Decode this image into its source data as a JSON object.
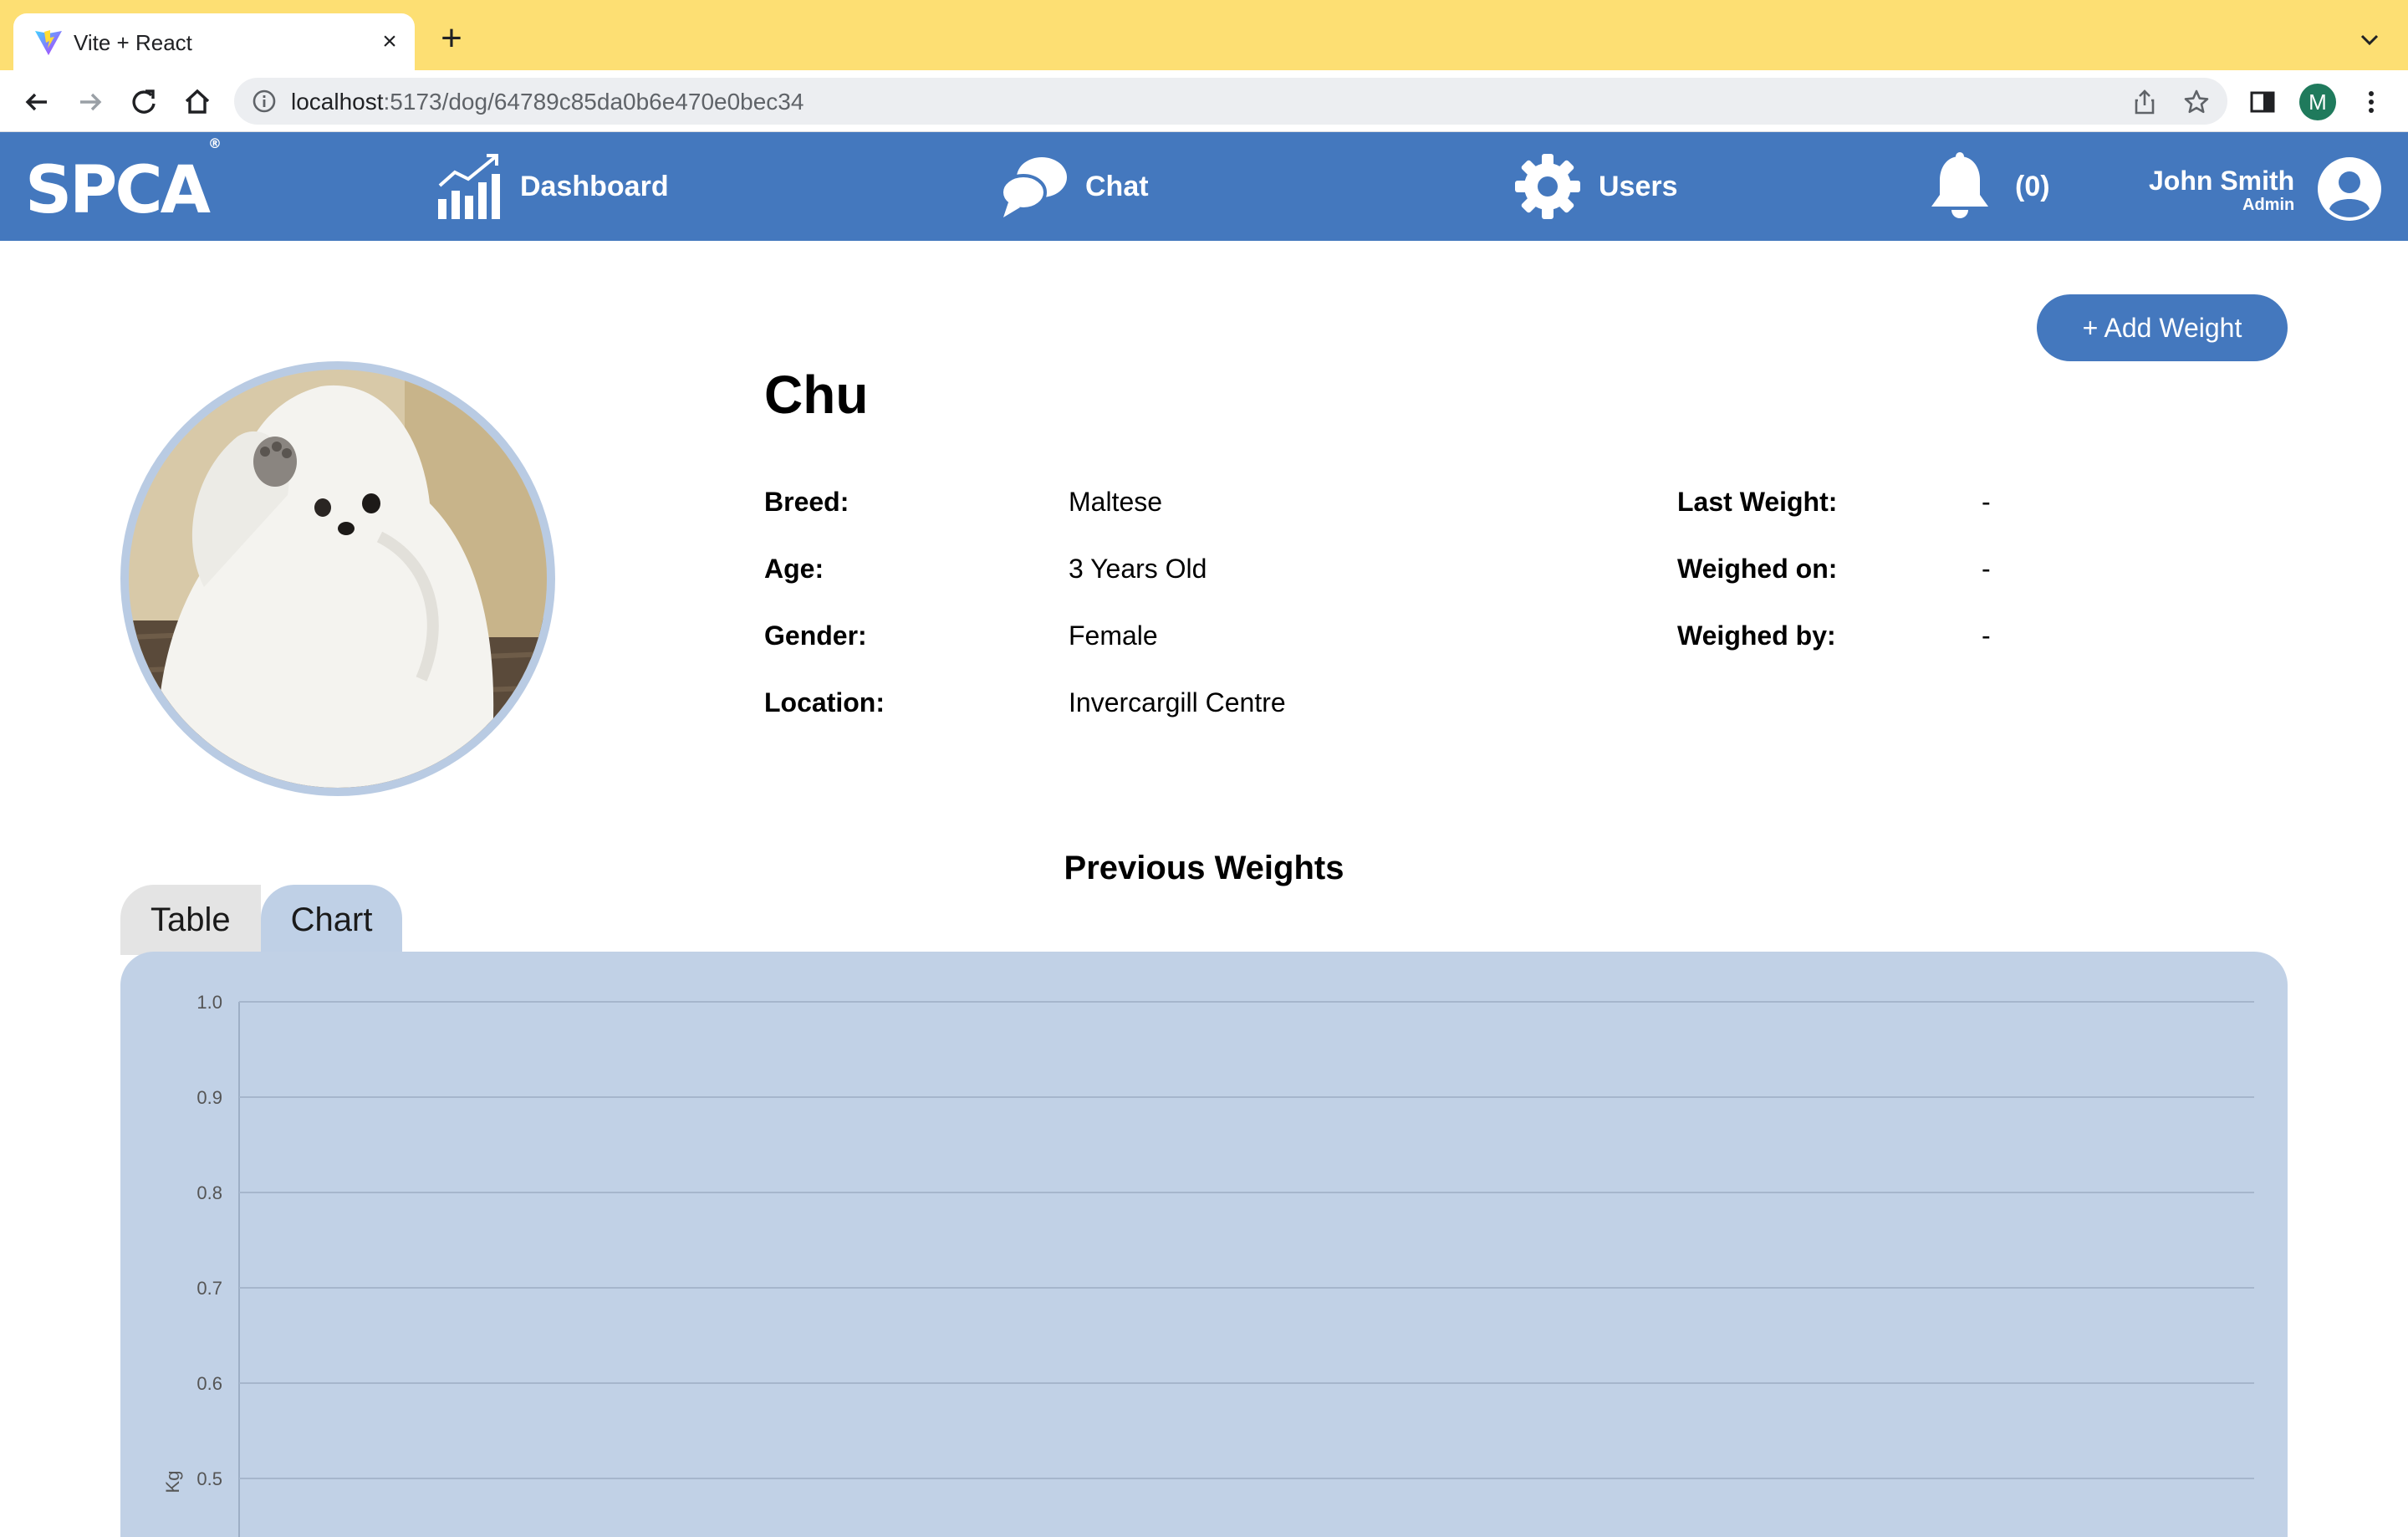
{
  "browser": {
    "tab_title": "Vite + React",
    "url_host": "localhost",
    "url_path": ":5173/dog/64789c85da0b6e470e0bec34",
    "profile_initial": "M"
  },
  "nav": {
    "logo": "SPCA",
    "logo_mark": "®",
    "dashboard": "Dashboard",
    "chat": "Chat",
    "users": "Users",
    "notifications": "(0)",
    "user_name": "John Smith",
    "user_role": "Admin"
  },
  "actions": {
    "add_weight": "+ Add Weight"
  },
  "dog": {
    "name": "Chu",
    "breed_label": "Breed:",
    "breed": "Maltese",
    "age_label": "Age:",
    "age": "3 Years Old",
    "gender_label": "Gender:",
    "gender": "Female",
    "location_label": "Location:",
    "location": "Invercargill Centre",
    "last_weight_label": "Last Weight:",
    "last_weight": "-",
    "weighed_on_label": "Weighed on:",
    "weighed_on": "-",
    "weighed_by_label": "Weighed by:",
    "weighed_by": "-"
  },
  "weights": {
    "title": "Previous Weights",
    "tabs": [
      "Table",
      "Chart"
    ],
    "active_tab": "Chart"
  },
  "chart_data": {
    "type": "line",
    "x": [],
    "series": [],
    "ylabel": "Kg",
    "ylim": [
      0.5,
      1.0
    ],
    "yticks": [
      "1.0",
      "0.9",
      "0.8",
      "0.7",
      "0.6",
      "0.5"
    ],
    "grid": true
  },
  "colors": {
    "brand": "#4478be",
    "chart_bg": "#c1d1e6",
    "tabbar": "#fddf73"
  }
}
